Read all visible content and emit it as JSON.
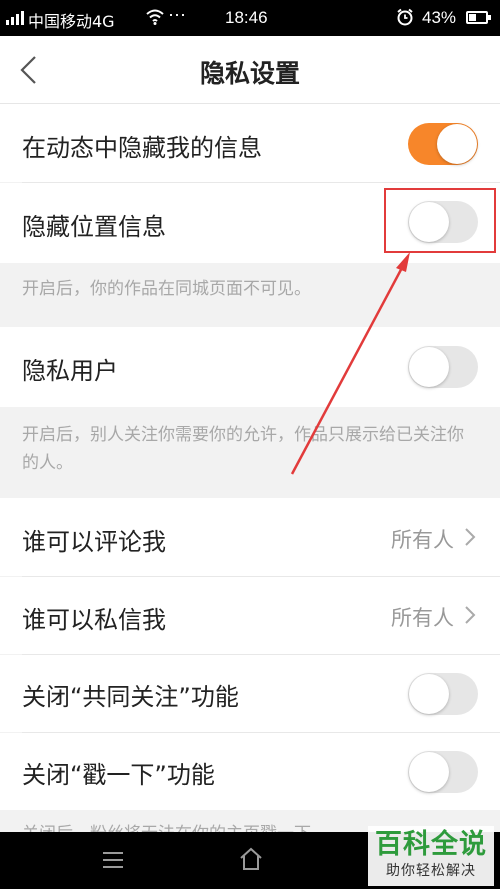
{
  "status_bar": {
    "carrier": "中国移动4G",
    "time": "18:46",
    "battery_percent": "43%",
    "battery_level": 0.43,
    "icons": [
      "signal-icon",
      "wifi-icon",
      "more-dots-icon",
      "alarm-icon",
      "battery-icon"
    ]
  },
  "header": {
    "title": "隐私设置",
    "back_icon": "chevron-left-icon"
  },
  "settings": {
    "hide_in_feed": {
      "label": "在动态中隐藏我的信息",
      "enabled": true
    },
    "hide_location": {
      "label": "隐藏位置信息",
      "enabled": false
    },
    "hide_location_hint": "开启后，你的作品在同城页面不可见。",
    "private_user": {
      "label": "隐私用户",
      "enabled": false
    },
    "private_user_hint": "开启后，别人关注你需要你的允许，作品只展示给已关注你的人。",
    "who_can_comment": {
      "label": "谁可以评论我",
      "value": "所有人"
    },
    "who_can_message": {
      "label": "谁可以私信我",
      "value": "所有人"
    },
    "close_mutual_follow": {
      "label": "关闭“共同关注”功能",
      "enabled": false
    },
    "close_poke": {
      "label": "关闭“戳一下”功能",
      "enabled": false
    },
    "bottom_hint_partial": "关闭后，粉丝将无法在你的主页戳一下"
  },
  "colors": {
    "accent": "#f7862a",
    "annotation": "#e23b3b",
    "watermark": "#2e9b3c"
  },
  "watermark": {
    "title": "百科全说",
    "subtitle": "助你轻松解决"
  },
  "nav_bar": {
    "icons": [
      "menu-icon",
      "home-icon"
    ]
  }
}
